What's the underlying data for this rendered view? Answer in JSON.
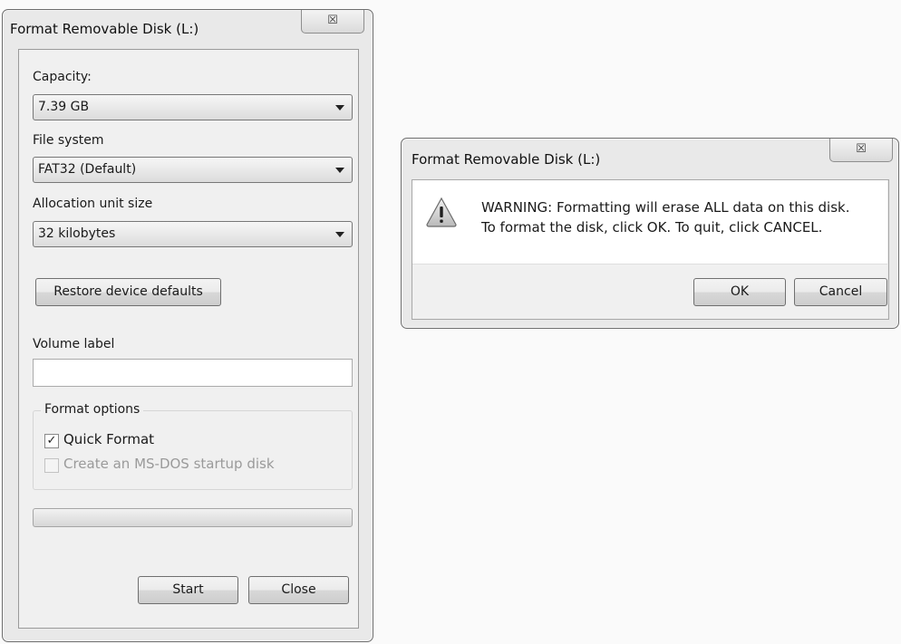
{
  "format_dialog": {
    "title": "Format Removable Disk (L:)",
    "close_glyph": "☒",
    "capacity": {
      "label": "Capacity:",
      "value": "7.39 GB"
    },
    "file_system": {
      "label": "File system",
      "value": "FAT32 (Default)"
    },
    "allocation": {
      "label": "Allocation unit size",
      "value": "32 kilobytes"
    },
    "restore_label": "Restore device defaults",
    "volume_label": {
      "label": "Volume label",
      "value": ""
    },
    "format_options": {
      "title": "Format options",
      "quick_format": {
        "label": "Quick Format",
        "checked": true
      },
      "msdos": {
        "label": "Create an MS-DOS startup disk",
        "checked": false,
        "disabled": true
      }
    },
    "progress": 0,
    "start_label": "Start",
    "close_label": "Close"
  },
  "warning_dialog": {
    "title": "Format Removable Disk (L:)",
    "close_glyph": "☒",
    "icon": "warning-triangle-icon",
    "message_line1": "WARNING: Formatting will erase ALL data on this disk.",
    "message_line2": "To format the disk, click OK. To quit, click CANCEL.",
    "ok_label": "OK",
    "cancel_label": "Cancel"
  }
}
